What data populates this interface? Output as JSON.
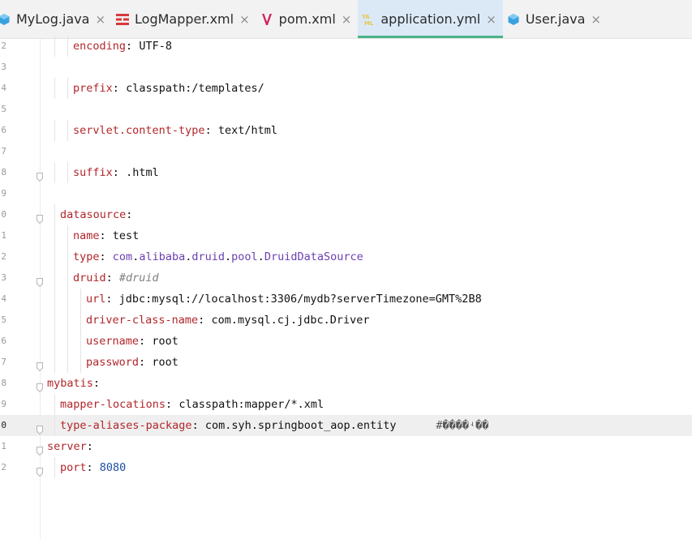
{
  "tabs": [
    {
      "label": "MyLog.java",
      "icon": "java-class-icon",
      "color": "#3aa1e0"
    },
    {
      "label": "LogMapper.xml",
      "icon": "mapper-xml-icon",
      "color": "#d9383a"
    },
    {
      "label": "pom.xml",
      "icon": "maven-icon",
      "color": "#d0245c"
    },
    {
      "label": "application.yml",
      "icon": "yaml-icon",
      "color": "#e8c64b",
      "active": true
    },
    {
      "label": "User.java",
      "icon": "java-class-icon",
      "color": "#3aa1e0"
    }
  ],
  "lines": [
    {
      "ln": "2",
      "indent": 1,
      "key": "encoding",
      "value": "UTF-8"
    },
    {
      "ln": "3"
    },
    {
      "ln": "4",
      "indent": 1,
      "key": "prefix",
      "value": "classpath:/templates/"
    },
    {
      "ln": "5"
    },
    {
      "ln": "6",
      "indent": 1,
      "key": "servlet.content-type",
      "value": "text/html"
    },
    {
      "ln": "7"
    },
    {
      "ln": "8",
      "indent": 1,
      "key": "suffix",
      "value": ".html",
      "fold": true
    },
    {
      "ln": "9"
    },
    {
      "ln": "0",
      "indent": 0,
      "key": "datasource",
      "fold": true
    },
    {
      "ln": "1",
      "indent": 1,
      "key": "name",
      "value": "test"
    },
    {
      "ln": "2",
      "indent": 1,
      "key": "type",
      "pkg": [
        "com",
        "alibaba",
        "druid",
        "pool"
      ],
      "cls": "DruidDataSource"
    },
    {
      "ln": "3",
      "indent": 1,
      "key": "druid",
      "comment": "#druid",
      "fold": true
    },
    {
      "ln": "4",
      "indent": 2,
      "key": "url",
      "value": "jdbc:mysql://localhost:3306/mydb?serverTimezone=GMT%2B8"
    },
    {
      "ln": "5",
      "indent": 2,
      "key": "driver-class-name",
      "value": "com.mysql.cj.jdbc.Driver"
    },
    {
      "ln": "6",
      "indent": 2,
      "key": "username",
      "value": "root"
    },
    {
      "ln": "7",
      "indent": 2,
      "key": "password",
      "value": "root",
      "fold": true
    },
    {
      "ln": "8",
      "indent": -1,
      "key": "mybatis",
      "fold": true
    },
    {
      "ln": "9",
      "indent": 0,
      "key": "mapper-locations",
      "value": "classpath:mapper/*.xml"
    },
    {
      "ln": "0",
      "indent": 0,
      "key": "type-aliases-package",
      "value": "com.syh.springboot_aop.entity",
      "comment": "#����ʵ��",
      "current": true,
      "fold": true
    },
    {
      "ln": "1",
      "indent": -1,
      "key": "server",
      "fold": true
    },
    {
      "ln": "2",
      "indent": 0,
      "key": "port",
      "number": "8080",
      "fold": true
    }
  ]
}
